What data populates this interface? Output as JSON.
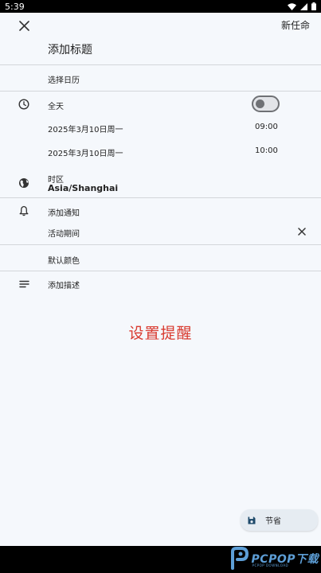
{
  "status_bar": {
    "time": "5:39"
  },
  "app_bar": {
    "action_label": "新任命"
  },
  "form": {
    "title_placeholder": "添加标题",
    "calendar_label": "选择日历",
    "all_day_label": "全天",
    "start_date": "2025年3月10日周一",
    "start_time": "09:00",
    "end_date": "2025年3月10日周一",
    "end_time": "10:00",
    "timezone_label": "时区",
    "timezone_value": "Asia/Shanghai",
    "notification_label": "添加通知",
    "notification_value": "活动期间",
    "color_label": "默认颜色",
    "description_label": "添加描述"
  },
  "overlay_text": "设置提醒",
  "save_button": {
    "label": "节省"
  },
  "logo": {
    "text": "PCPOP下载",
    "subtext": "PCPOP DOWNLOAD"
  },
  "colors": {
    "overlay": "#d93a2f",
    "logo": "#5d9ed6"
  }
}
